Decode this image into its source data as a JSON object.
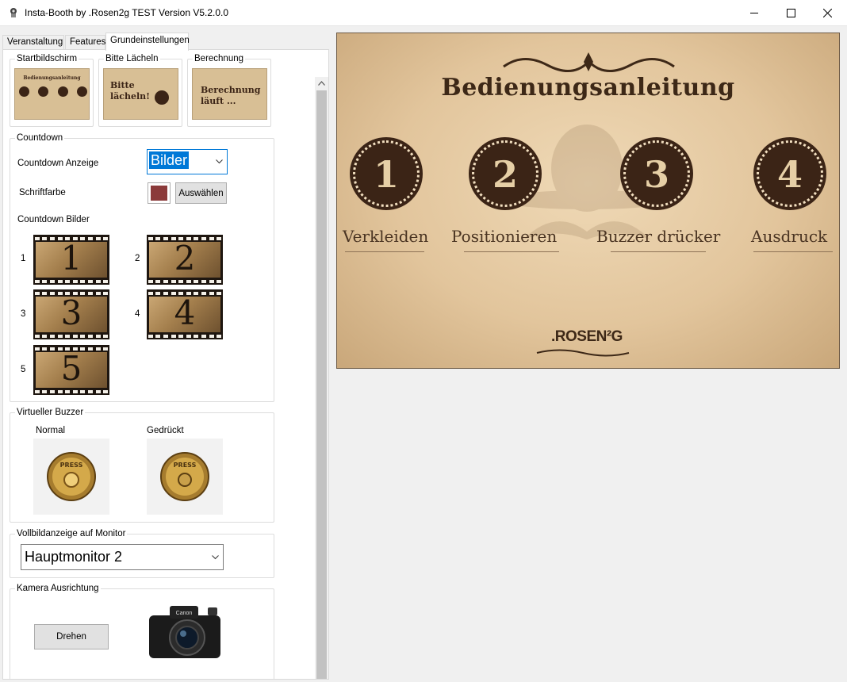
{
  "window": {
    "title": "Insta-Booth by .Rosen2g TEST Version V5.2.0.0",
    "icon": "app-icon",
    "controls": [
      "minimize-icon",
      "maximize-icon",
      "close-icon"
    ]
  },
  "tabs": [
    {
      "label": "Veranstaltung",
      "active": false
    },
    {
      "label": "Features",
      "active": false
    },
    {
      "label": "Grundeinstellungen",
      "active": true
    }
  ],
  "screens": {
    "startbildschirm": {
      "label": "Startbildschirm",
      "thumb_text": "Bedienungsanleitung"
    },
    "bitte_laecheln": {
      "label": "Bitte Lächeln",
      "thumb_text": "Bitte\nlächeln!"
    },
    "berechnung": {
      "label": "Berechnung",
      "thumb_text": "Berechnung\nläuft ..."
    }
  },
  "countdown": {
    "group_label": "Countdown",
    "anzeige_label": "Countdown Anzeige",
    "anzeige_value": "Bilder",
    "schriftfarbe_label": "Schriftfarbe",
    "schriftfarbe_color": "#8b3a3a",
    "auswaehlen_label": "Auswählen",
    "bilder_label": "Countdown Bilder",
    "images": [
      {
        "index": "1",
        "digit": "1"
      },
      {
        "index": "2",
        "digit": "2"
      },
      {
        "index": "3",
        "digit": "3"
      },
      {
        "index": "4",
        "digit": "4"
      },
      {
        "index": "5",
        "digit": "5"
      }
    ]
  },
  "buzzer": {
    "group_label": "Virtueller Buzzer",
    "normal_label": "Normal",
    "gedrueckt_label": "Gedrückt",
    "button_text": "PRESS"
  },
  "monitor": {
    "group_label": "Vollbildanzeige auf Monitor",
    "value": "Hauptmonitor 2"
  },
  "kamera": {
    "group_label": "Kamera Ausrichtung",
    "drehen_label": "Drehen",
    "camera_brand": "Canon"
  },
  "preview": {
    "title": "Bedienungsanleitung",
    "steps": [
      {
        "number": "1",
        "label": "Verkleiden"
      },
      {
        "number": "2",
        "label": "Positionieren"
      },
      {
        "number": "3",
        "label": "Buzzer drücker"
      },
      {
        "number": "4",
        "label": "Ausdruck"
      }
    ],
    "brand": ".ROSEN²G",
    "colors": {
      "paper": "#e2c59c",
      "ink": "#3b2416"
    }
  }
}
